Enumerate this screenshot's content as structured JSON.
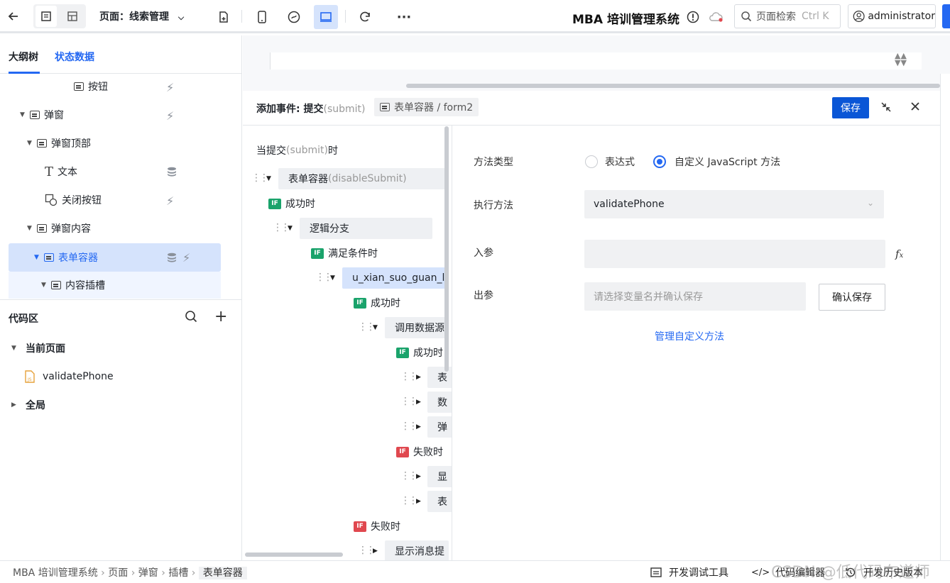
{
  "topbar": {
    "page_label": "页面：线索管理",
    "app_title": "MBA 培训管理系统",
    "search": {
      "label": "页面检索",
      "shortcut": "Ctrl K"
    },
    "user": "administrator"
  },
  "outline": {
    "tabs": [
      "大纲树",
      "状态数据"
    ],
    "nodes": [
      {
        "label": "按钮"
      },
      {
        "label": "弹窗"
      },
      {
        "label": "弹窗顶部"
      },
      {
        "label": "文本"
      },
      {
        "label": "关闭按钮"
      },
      {
        "label": "弹窗内容"
      },
      {
        "label": "表单容器"
      },
      {
        "label": "内容插槽"
      }
    ]
  },
  "code": {
    "title": "代码区",
    "current_page": "当前页面",
    "file": "validatePhone",
    "global": "全局"
  },
  "event": {
    "title_prefix": "添加事件: 提交",
    "title_event": "(submit)",
    "target": "表单容器 / form2",
    "save": "保存",
    "trigger_prefix": "当提交",
    "trigger_event": "(submit)",
    "trigger_suffix": "时",
    "tree": {
      "form_node": "表单容器",
      "form_node_hint": " (disableSubmit)",
      "success1": "成功时",
      "logic": "逻辑分支",
      "cond": "满足条件时",
      "fn": "u_xian_suo_guan_li",
      "success2": "成功时",
      "datasource": "调用数据源",
      "success3": "成功时",
      "a1": "表",
      "a2": "数",
      "a3": "弹",
      "fail1": "失败时",
      "b1": "显",
      "b2": "表",
      "fail2": "失败时",
      "last": "显示消息提"
    },
    "if_badge": "IF"
  },
  "form": {
    "method_type_label": "方法类型",
    "opt_expr": "表达式",
    "opt_custom": "自定义 JavaScript 方法",
    "exec_label": "执行方法",
    "exec_value": "validatePhone",
    "in_label": "入参",
    "out_label": "出参",
    "out_placeholder": "请选择变量名并确认保存",
    "confirm": "确认保存",
    "manage": "管理自定义方法"
  },
  "bottom": {
    "crumbs": [
      "MBA 培训管理系统",
      "页面",
      "弹窗",
      "插槽",
      "表单容器"
    ],
    "tools": [
      "开发调试工具",
      "代码编辑器",
      "开发历史版本"
    ],
    "watermark": "CSDN @低代码布道师"
  },
  "colors": {
    "accent": "#2468f2",
    "success": "#1aa36b",
    "fail": "#e0484f"
  }
}
